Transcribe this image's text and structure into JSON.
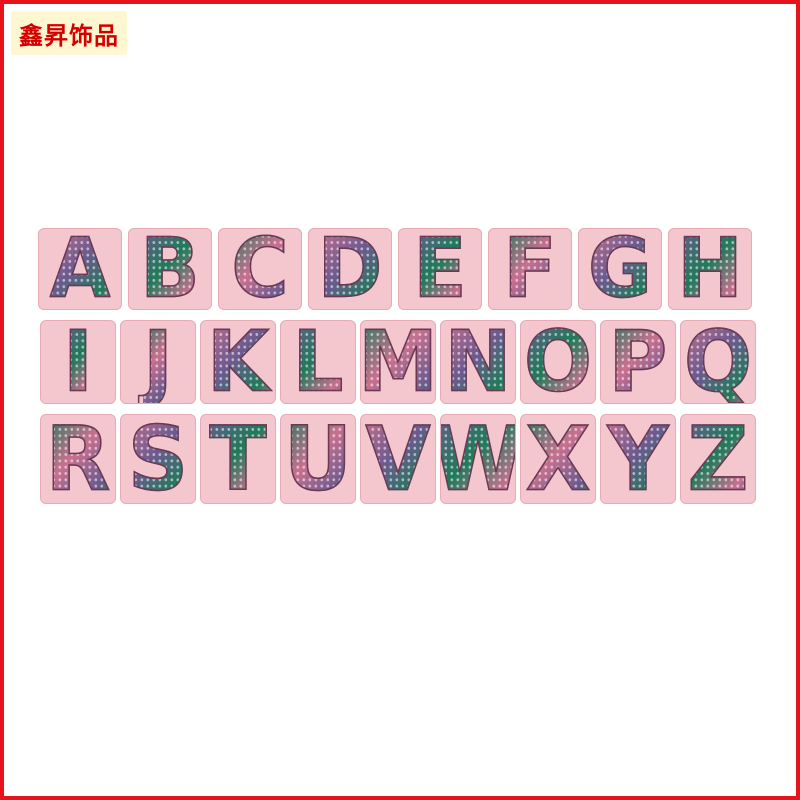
{
  "brand": {
    "text": "鑫昇饰品"
  },
  "letters": {
    "row1": [
      "A",
      "B",
      "C",
      "D",
      "E",
      "F",
      "G",
      "H"
    ],
    "row2": [
      "I",
      "J",
      "K",
      "L",
      "M",
      "N",
      "O",
      "P",
      "Q"
    ],
    "row3": [
      "R",
      "S",
      "T",
      "U",
      "V",
      "W",
      "X",
      "Y",
      "Z"
    ]
  },
  "colors": {
    "frame": "#e8121a",
    "brand_text": "#d40000",
    "patch_background": "#f4c7cf",
    "sequin_pink": "#c9708f",
    "sequin_purple": "#6c5a8f",
    "sequin_green": "#1f7a5a"
  }
}
